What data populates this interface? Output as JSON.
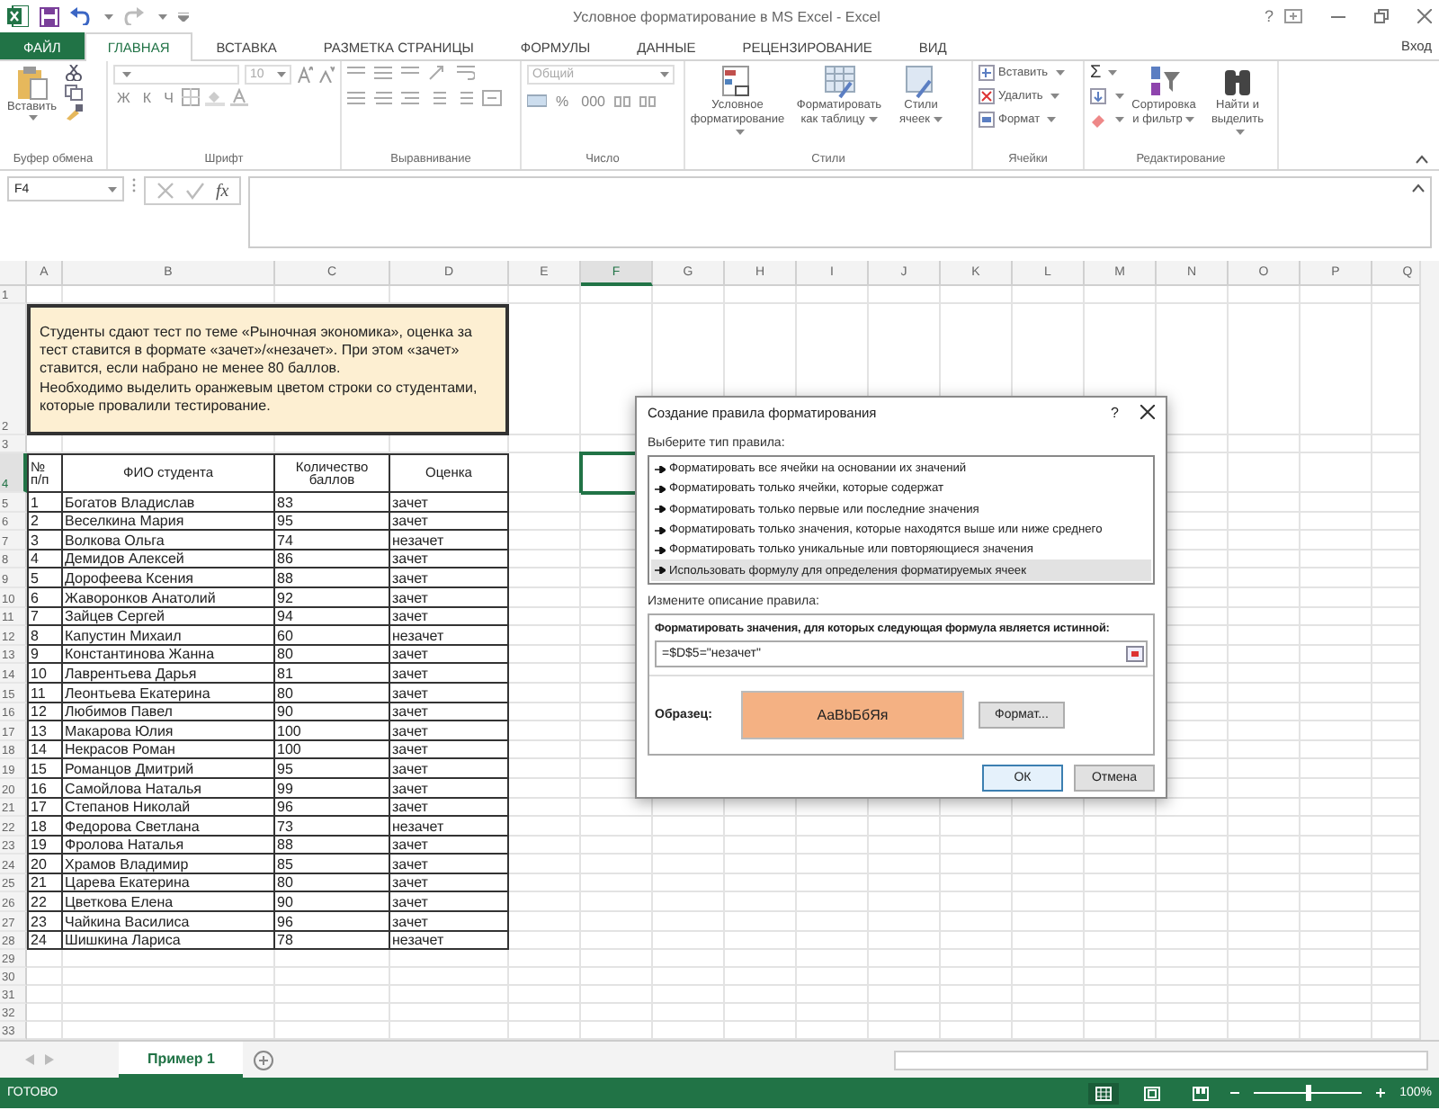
{
  "window": {
    "title": "Условное форматирование в MS Excel - Excel",
    "help": "?"
  },
  "ribbon_tabs": [
    {
      "label": "ФАЙЛ",
      "kind": "file",
      "selected": false
    },
    {
      "label": "ГЛАВНАЯ",
      "kind": "tab",
      "selected": true
    },
    {
      "label": "ВСТАВКА",
      "kind": "tab",
      "selected": false
    },
    {
      "label": "РАЗМЕТКА СТРАНИЦЫ",
      "kind": "tab",
      "selected": false
    },
    {
      "label": "ФОРМУЛЫ",
      "kind": "tab",
      "selected": false
    },
    {
      "label": "ДАННЫЕ",
      "kind": "tab",
      "selected": false
    },
    {
      "label": "РЕЦЕНЗИРОВАНИЕ",
      "kind": "tab",
      "selected": false
    },
    {
      "label": "ВИД",
      "kind": "tab",
      "selected": false
    }
  ],
  "sign_in": "Вход",
  "ribbon_groups": [
    {
      "kind": "clipboard",
      "label": "Буфер обмена",
      "paste": "Вставить"
    },
    {
      "kind": "font",
      "label": "Шрифт",
      "size": "10",
      "styles": [
        "Ж",
        "К",
        "Ч"
      ]
    },
    {
      "kind": "alignment",
      "label": "Выравнивание"
    },
    {
      "kind": "number",
      "label": "Число",
      "format": "Общий",
      "buttons": [
        "%",
        "000"
      ]
    },
    {
      "kind": "large",
      "label": "Стили",
      "buttons": [
        "Условное форматирование",
        "Форматировать как таблицу",
        "Стили ячеек"
      ]
    },
    {
      "kind": "small",
      "label": "Ячейки",
      "buttons": [
        "Вставить",
        "Удалить",
        "Формат"
      ]
    },
    {
      "kind": "editing",
      "label": "Редактирование",
      "sum": "Σ",
      "buttons": [
        "Сортировка и фильтр",
        "Найти и выделить"
      ]
    }
  ],
  "formula_bar": {
    "name_box": "F4",
    "function_label": "fx"
  },
  "sheet": {
    "columns": [
      {
        "label": "A",
        "selected": false
      },
      {
        "label": "B",
        "selected": false
      },
      {
        "label": "C",
        "selected": false
      },
      {
        "label": "D",
        "selected": false
      },
      {
        "label": "E",
        "selected": false
      },
      {
        "label": "F",
        "selected": true
      },
      {
        "label": "G",
        "selected": false
      },
      {
        "label": "H",
        "selected": false
      },
      {
        "label": "I",
        "selected": false
      },
      {
        "label": "J",
        "selected": false
      },
      {
        "label": "K",
        "selected": false
      },
      {
        "label": "L",
        "selected": false
      },
      {
        "label": "M",
        "selected": false
      },
      {
        "label": "N",
        "selected": false
      },
      {
        "label": "O",
        "selected": false
      },
      {
        "label": "P",
        "selected": false
      },
      {
        "label": "Q",
        "selected": false
      }
    ],
    "rows": [
      {
        "number": "1",
        "kind": "empty",
        "selected": false
      },
      {
        "number": "2",
        "kind": "note",
        "selected": false,
        "paragraphs": [
          "Студенты сдают тест по теме «Рыночная экономика», оценка за тест ставится в формате «зачет»/«незачет». При этом «зачет» ставится, если набрано не менее 80 баллов.",
          "Необходимо выделить оранжевым цветом строки со студентами, которые провалили тестирование."
        ]
      },
      {
        "number": "3",
        "kind": "empty",
        "selected": false
      },
      {
        "number": "4",
        "kind": "header",
        "selected": true,
        "cells": [
          "№ п/п",
          "ФИО студента",
          "Количество баллов",
          "Оценка"
        ]
      },
      {
        "number": "5",
        "kind": "data",
        "selected": false,
        "cells": [
          "1",
          "Богатов Владислав",
          "83",
          "зачет"
        ]
      },
      {
        "number": "6",
        "kind": "data",
        "selected": false,
        "cells": [
          "2",
          "Веселкина Мария",
          "95",
          "зачет"
        ]
      },
      {
        "number": "7",
        "kind": "data",
        "selected": false,
        "cells": [
          "3",
          "Волкова Ольга",
          "74",
          "незачет"
        ]
      },
      {
        "number": "8",
        "kind": "data",
        "selected": false,
        "cells": [
          "4",
          "Демидов Алексей",
          "86",
          "зачет"
        ]
      },
      {
        "number": "9",
        "kind": "data",
        "selected": false,
        "cells": [
          "5",
          "Дорофеева Ксения",
          "88",
          "зачет"
        ]
      },
      {
        "number": "10",
        "kind": "data",
        "selected": false,
        "cells": [
          "6",
          "Жаворонков Анатолий",
          "92",
          "зачет"
        ]
      },
      {
        "number": "11",
        "kind": "data",
        "selected": false,
        "cells": [
          "7",
          "Зайцев Сергей",
          "94",
          "зачет"
        ]
      },
      {
        "number": "12",
        "kind": "data",
        "selected": false,
        "cells": [
          "8",
          "Капустин Михаил",
          "60",
          "незачет"
        ]
      },
      {
        "number": "13",
        "kind": "data",
        "selected": false,
        "cells": [
          "9",
          "Константинова Жанна",
          "80",
          "зачет"
        ]
      },
      {
        "number": "14",
        "kind": "data",
        "selected": false,
        "cells": [
          "10",
          "Лаврентьева Дарья",
          "81",
          "зачет"
        ]
      },
      {
        "number": "15",
        "kind": "data",
        "selected": false,
        "cells": [
          "11",
          "Леонтьева Екатерина",
          "80",
          "зачет"
        ]
      },
      {
        "number": "16",
        "kind": "data",
        "selected": false,
        "cells": [
          "12",
          "Любимов Павел",
          "90",
          "зачет"
        ]
      },
      {
        "number": "17",
        "kind": "data",
        "selected": false,
        "cells": [
          "13",
          "Макарова Юлия",
          "100",
          "зачет"
        ]
      },
      {
        "number": "18",
        "kind": "data",
        "selected": false,
        "cells": [
          "14",
          "Некрасов Роман",
          "100",
          "зачет"
        ]
      },
      {
        "number": "19",
        "kind": "data",
        "selected": false,
        "cells": [
          "15",
          "Романцов Дмитрий",
          "95",
          "зачет"
        ]
      },
      {
        "number": "20",
        "kind": "data",
        "selected": false,
        "cells": [
          "16",
          "Самойлова Наталья",
          "99",
          "зачет"
        ]
      },
      {
        "number": "21",
        "kind": "data",
        "selected": false,
        "cells": [
          "17",
          "Степанов Николай",
          "96",
          "зачет"
        ]
      },
      {
        "number": "22",
        "kind": "data",
        "selected": false,
        "cells": [
          "18",
          "Федорова Светлана",
          "73",
          "незачет"
        ]
      },
      {
        "number": "23",
        "kind": "data",
        "selected": false,
        "cells": [
          "19",
          "Фролова Наталья",
          "88",
          "зачет"
        ]
      },
      {
        "number": "24",
        "kind": "data",
        "selected": false,
        "cells": [
          "20",
          "Храмов Владимир",
          "85",
          "зачет"
        ]
      },
      {
        "number": "25",
        "kind": "data",
        "selected": false,
        "cells": [
          "21",
          "Царева Екатерина",
          "80",
          "зачет"
        ]
      },
      {
        "number": "26",
        "kind": "data",
        "selected": false,
        "cells": [
          "22",
          "Цветкова Елена",
          "90",
          "зачет"
        ]
      },
      {
        "number": "27",
        "kind": "data",
        "selected": false,
        "cells": [
          "23",
          "Чайкина Василиса",
          "96",
          "зачет"
        ]
      },
      {
        "number": "28",
        "kind": "data",
        "selected": false,
        "cells": [
          "24",
          "Шишкина Лариса",
          "78",
          "незачет"
        ]
      },
      {
        "number": "29",
        "kind": "empty",
        "selected": false
      },
      {
        "number": "30",
        "kind": "empty",
        "selected": false
      },
      {
        "number": "31",
        "kind": "empty",
        "selected": false
      },
      {
        "number": "32",
        "kind": "empty",
        "selected": false
      },
      {
        "number": "33",
        "kind": "empty",
        "selected": false
      }
    ]
  },
  "dialog": {
    "title": "Создание правила форматирования",
    "help": "?",
    "rule_type_label": "Выберите тип правила:",
    "rule_types": [
      {
        "label": "Форматировать все ячейки на основании их значений",
        "selected": false
      },
      {
        "label": "Форматировать только ячейки, которые содержат",
        "selected": false
      },
      {
        "label": "Форматировать только первые или последние значения",
        "selected": false
      },
      {
        "label": "Форматировать только значения, которые находятся выше или ниже среднего",
        "selected": false
      },
      {
        "label": "Форматировать только уникальные или повторяющиеся значения",
        "selected": false
      },
      {
        "label": "Использовать формулу для определения форматируемых ячеек",
        "selected": true
      }
    ],
    "description_label": "Измените описание правила:",
    "formula_label": "Форматировать значения, для которых следующая формула является истинной:",
    "formula": "=$D$5=\"незачет\"",
    "preview_label": "Образец:",
    "preview_text": "AaBbБбЯя",
    "format_button": "Формат...",
    "ok_button": "ОК",
    "cancel_button": "Отмена"
  },
  "sheet_tabs": [
    {
      "label": "Пример 1",
      "selected": true
    }
  ],
  "status_bar": {
    "status": "ГОТОВО",
    "views": [
      {
        "selected": true
      },
      {
        "selected": false
      },
      {
        "selected": false
      }
    ],
    "zoom_slider": {
      "level": 0.5
    },
    "zoom": "100%"
  }
}
